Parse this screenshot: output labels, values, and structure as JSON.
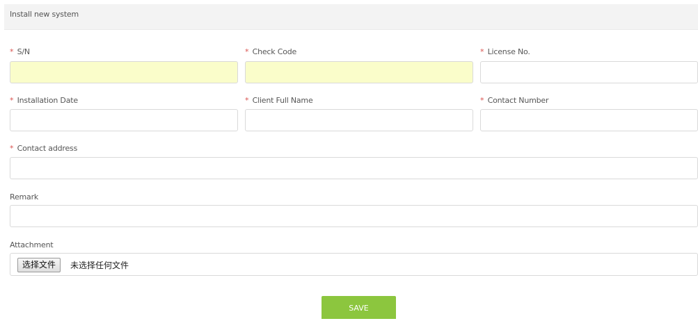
{
  "panel": {
    "title": "Install new system"
  },
  "required_marker": "*",
  "fields": {
    "sn": {
      "label": "S/N",
      "value": "",
      "placeholder": ""
    },
    "check_code": {
      "label": "Check Code",
      "value": "",
      "placeholder": ""
    },
    "license_no": {
      "label": "License No.",
      "value": "",
      "placeholder": ""
    },
    "installation_date": {
      "label": "Installation Date",
      "value": "",
      "placeholder": ""
    },
    "client_full_name": {
      "label": "Client Full Name",
      "value": "",
      "placeholder": ""
    },
    "contact_number": {
      "label": "Contact Number",
      "value": "",
      "placeholder": ""
    },
    "contact_address": {
      "label": "Contact address",
      "value": "",
      "placeholder": ""
    },
    "remark": {
      "label": "Remark",
      "value": "",
      "placeholder": ""
    }
  },
  "attachment": {
    "label": "Attachment",
    "button_label": "选择文件",
    "status": "未选择任何文件"
  },
  "save": {
    "label": "SAVE"
  },
  "colors": {
    "accent": "#8cc63e",
    "required": "#d9534f",
    "autofill": "#fafdca",
    "header_bg": "#f3f3f3"
  }
}
